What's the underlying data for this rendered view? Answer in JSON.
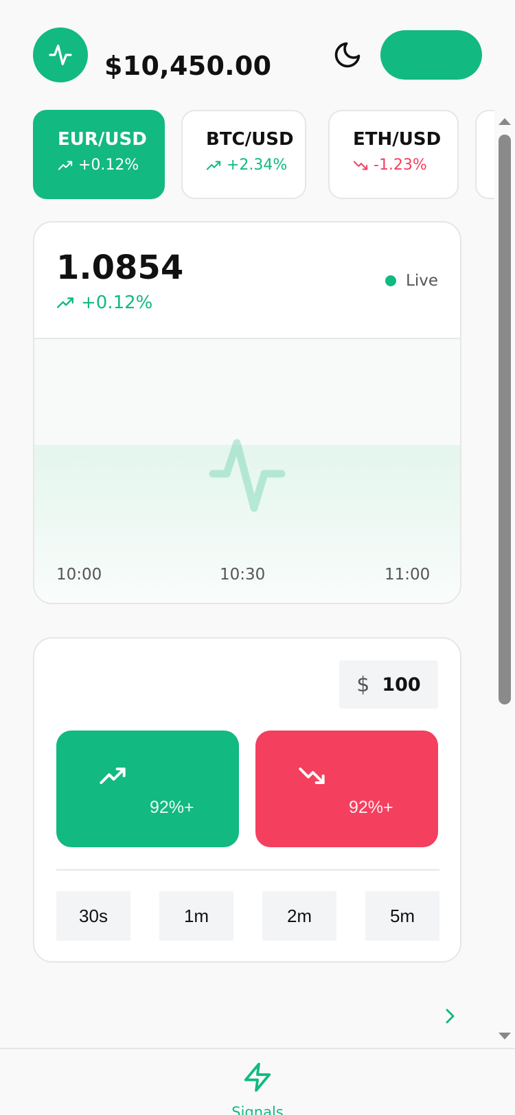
{
  "header": {
    "balance": "$10,450.00"
  },
  "pairs": [
    {
      "name": "EUR/USD",
      "change": "+0.12%",
      "direction": "up",
      "active": true
    },
    {
      "name": "BTC/USD",
      "change": "+2.34%",
      "direction": "up",
      "active": false
    },
    {
      "name": "ETH/USD",
      "change": "-1.23%",
      "direction": "down",
      "active": false
    }
  ],
  "chart": {
    "price": "1.0854",
    "change": "+0.12%",
    "status": "Live",
    "time_ticks": [
      "10:00",
      "10:30",
      "11:00"
    ]
  },
  "trade": {
    "amount_symbol": "$",
    "amount": "100",
    "up_payout": "92%+",
    "down_payout": "92%+",
    "durations": [
      "30s",
      "1m",
      "2m",
      "5m"
    ]
  },
  "nav": {
    "signals_label": "Signals"
  },
  "colors": {
    "accent": "#12b981",
    "negative": "#f43f5e"
  },
  "icons": {
    "logo": "activity-pulse-icon",
    "theme": "moon-icon",
    "up": "trending-up-icon",
    "down": "trending-down-icon",
    "chevron": "chevron-right-icon",
    "signals": "lightning-icon"
  }
}
